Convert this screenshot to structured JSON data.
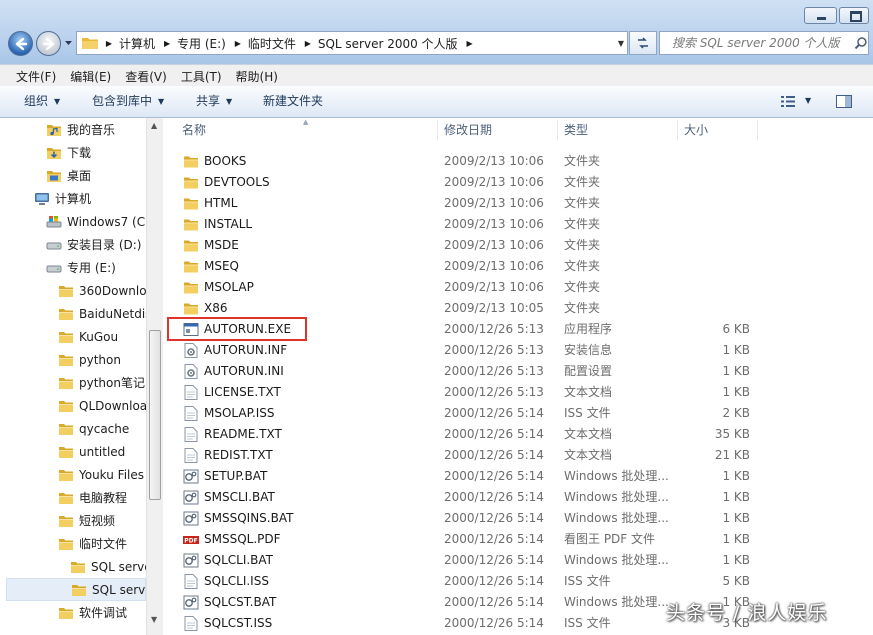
{
  "window": {
    "address_crumbs": [
      "计算机",
      "专用 (E:)",
      "临时文件",
      "SQL server 2000 个人版"
    ],
    "search_placeholder": "搜索 SQL server 2000 个人版"
  },
  "menu": [
    "文件(F)",
    "编辑(E)",
    "查看(V)",
    "工具(T)",
    "帮助(H)"
  ],
  "toolbar": {
    "organize": "组织",
    "include_library": "包含到库中",
    "share": "共享",
    "new_folder": "新建文件夹"
  },
  "nav_pane": {
    "items": [
      {
        "label": "我的音乐",
        "icon": "music-library-icon"
      },
      {
        "label": "下载",
        "icon": "downloads-folder-icon"
      },
      {
        "label": "桌面",
        "icon": "desktop-folder-icon"
      },
      {
        "label": "计算机",
        "icon": "computer-icon"
      },
      {
        "label": "Windows7 (C:",
        "icon": "system-drive-icon"
      },
      {
        "label": "安装目录 (D:)",
        "icon": "drive-icon"
      },
      {
        "label": "专用 (E:)",
        "icon": "drive-icon"
      },
      {
        "label": "360Downloa",
        "icon": "folder-icon"
      },
      {
        "label": "BaiduNetdis",
        "icon": "folder-icon"
      },
      {
        "label": "KuGou",
        "icon": "folder-icon"
      },
      {
        "label": "python",
        "icon": "folder-icon"
      },
      {
        "label": "python笔记",
        "icon": "folder-icon"
      },
      {
        "label": "QLDownloa",
        "icon": "folder-icon"
      },
      {
        "label": "qycache",
        "icon": "folder-icon"
      },
      {
        "label": "untitled",
        "icon": "folder-icon"
      },
      {
        "label": "Youku Files",
        "icon": "folder-icon"
      },
      {
        "label": "电脑教程",
        "icon": "folder-icon"
      },
      {
        "label": "短视频",
        "icon": "folder-icon"
      },
      {
        "label": "临时文件",
        "icon": "folder-icon"
      },
      {
        "label": "SQL serve",
        "icon": "folder-icon"
      },
      {
        "label": "SQL serve",
        "icon": "folder-icon",
        "selected": true
      },
      {
        "label": "软件调试",
        "icon": "folder-icon"
      }
    ]
  },
  "columns": {
    "name": "名称",
    "date": "修改日期",
    "type": "类型",
    "size": "大小"
  },
  "files": [
    {
      "name": "BOOKS",
      "date": "2009/2/13 10:06",
      "type": "文件夹",
      "size": "",
      "icon": "folder-icon"
    },
    {
      "name": "DEVTOOLS",
      "date": "2009/2/13 10:06",
      "type": "文件夹",
      "size": "",
      "icon": "folder-icon"
    },
    {
      "name": "HTML",
      "date": "2009/2/13 10:06",
      "type": "文件夹",
      "size": "",
      "icon": "folder-icon"
    },
    {
      "name": "INSTALL",
      "date": "2009/2/13 10:06",
      "type": "文件夹",
      "size": "",
      "icon": "folder-icon"
    },
    {
      "name": "MSDE",
      "date": "2009/2/13 10:06",
      "type": "文件夹",
      "size": "",
      "icon": "folder-icon"
    },
    {
      "name": "MSEQ",
      "date": "2009/2/13 10:06",
      "type": "文件夹",
      "size": "",
      "icon": "folder-icon"
    },
    {
      "name": "MSOLAP",
      "date": "2009/2/13 10:06",
      "type": "文件夹",
      "size": "",
      "icon": "folder-icon"
    },
    {
      "name": "X86",
      "date": "2009/2/13 10:05",
      "type": "文件夹",
      "size": "",
      "icon": "folder-icon"
    },
    {
      "name": "AUTORUN.EXE",
      "date": "2000/12/26 5:13",
      "type": "应用程序",
      "size": "6 KB",
      "icon": "application-icon"
    },
    {
      "name": "AUTORUN.INF",
      "date": "2000/12/26 5:13",
      "type": "安装信息",
      "size": "1 KB",
      "icon": "settings-file-icon"
    },
    {
      "name": "AUTORUN.INI",
      "date": "2000/12/26 5:13",
      "type": "配置设置",
      "size": "1 KB",
      "icon": "settings-file-icon"
    },
    {
      "name": "LICENSE.TXT",
      "date": "2000/12/26 5:13",
      "type": "文本文档",
      "size": "1 KB",
      "icon": "text-file-icon"
    },
    {
      "name": "MSOLAP.ISS",
      "date": "2000/12/26 5:14",
      "type": "ISS 文件",
      "size": "2 KB",
      "icon": "text-file-icon"
    },
    {
      "name": "README.TXT",
      "date": "2000/12/26 5:14",
      "type": "文本文档",
      "size": "35 KB",
      "icon": "text-file-icon"
    },
    {
      "name": "REDIST.TXT",
      "date": "2000/12/26 5:14",
      "type": "文本文档",
      "size": "21 KB",
      "icon": "text-file-icon"
    },
    {
      "name": "SETUP.BAT",
      "date": "2000/12/26 5:14",
      "type": "Windows 批处理...",
      "size": "1 KB",
      "icon": "batch-file-icon"
    },
    {
      "name": "SMSCLI.BAT",
      "date": "2000/12/26 5:14",
      "type": "Windows 批处理...",
      "size": "1 KB",
      "icon": "batch-file-icon"
    },
    {
      "name": "SMSSQINS.BAT",
      "date": "2000/12/26 5:14",
      "type": "Windows 批处理...",
      "size": "1 KB",
      "icon": "batch-file-icon"
    },
    {
      "name": "SMSSQL.PDF",
      "date": "2000/12/26 5:14",
      "type": "看图王 PDF 文件",
      "size": "1 KB",
      "icon": "pdf-file-icon"
    },
    {
      "name": "SQLCLI.BAT",
      "date": "2000/12/26 5:14",
      "type": "Windows 批处理...",
      "size": "1 KB",
      "icon": "batch-file-icon"
    },
    {
      "name": "SQLCLI.ISS",
      "date": "2000/12/26 5:14",
      "type": "ISS 文件",
      "size": "5 KB",
      "icon": "text-file-icon"
    },
    {
      "name": "SQLCST.BAT",
      "date": "2000/12/26 5:14",
      "type": "Windows 批处理...",
      "size": "1 KB",
      "icon": "batch-file-icon"
    },
    {
      "name": "SQLCST.ISS",
      "date": "2000/12/26 5:14",
      "type": "ISS 文件",
      "size": "3 KB",
      "icon": "text-file-icon"
    }
  ],
  "watermark": "头条号 / 浪人娱乐",
  "colors": {
    "highlight_box": "#e0342b",
    "folder": "#f0c64a",
    "selection": "#e5eef8"
  }
}
